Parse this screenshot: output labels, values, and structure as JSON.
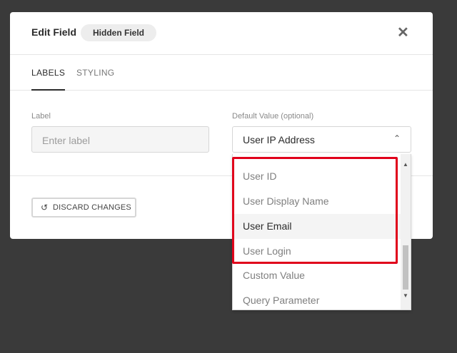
{
  "modal": {
    "title": "Edit Field",
    "badge": "Hidden Field",
    "close_glyph": "✕"
  },
  "tabs": [
    {
      "label": "LABELS",
      "active": true
    },
    {
      "label": "STYLING",
      "active": false
    }
  ],
  "label_field": {
    "label": "Label",
    "placeholder": "Enter label"
  },
  "default_value_field": {
    "label": "Default Value (optional)",
    "selected": "User IP Address",
    "chevron_glyph": "⌃",
    "options": [
      "User ID",
      "User Display Name",
      "User Email",
      "User Login",
      "Custom Value",
      "Query Parameter"
    ],
    "hovered_option": "User Email"
  },
  "footer": {
    "discard_label": "DISCARD CHANGES",
    "discard_icon": "undo-icon"
  },
  "annotation": {
    "highlight_color": "#e0001b"
  }
}
